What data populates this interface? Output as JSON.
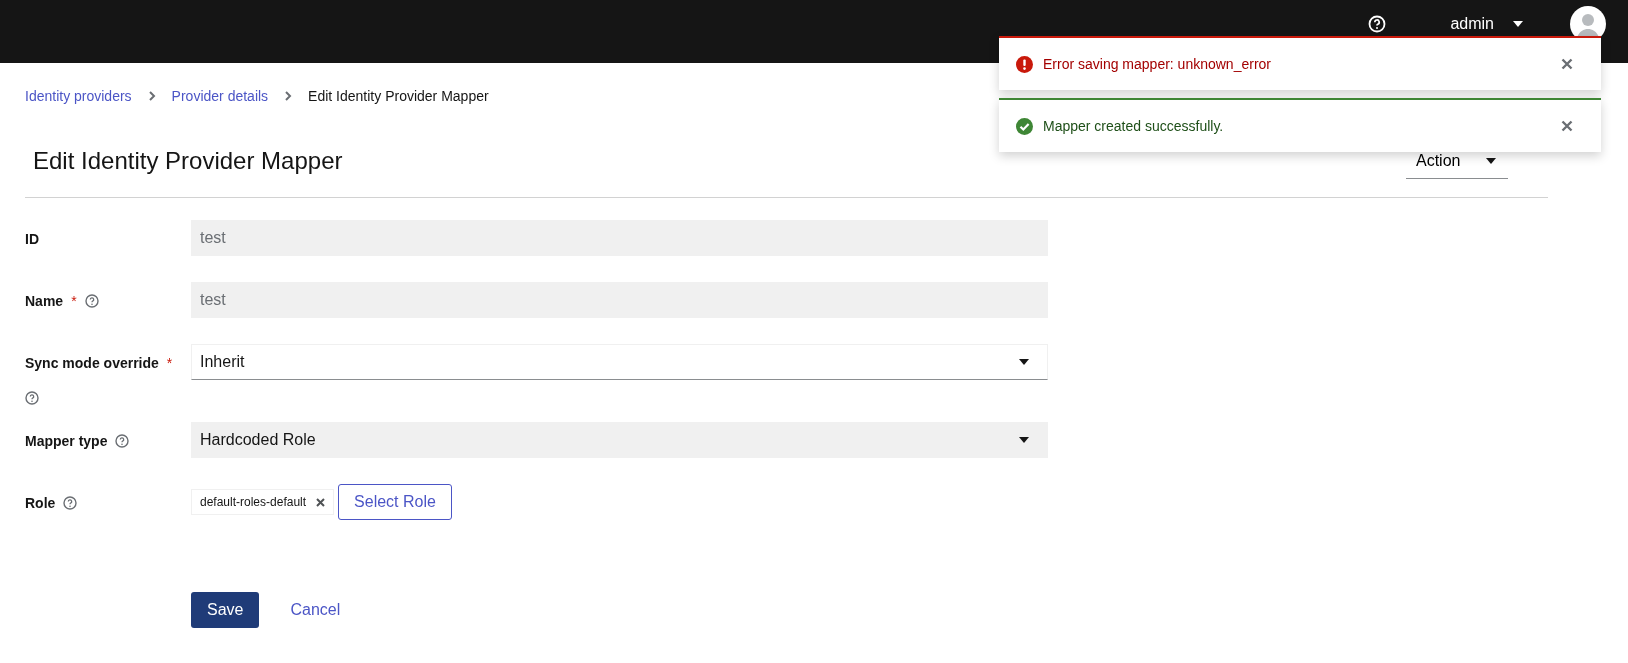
{
  "header": {
    "user": "admin"
  },
  "breadcrumbs": [
    {
      "label": "Identity providers",
      "current": false
    },
    {
      "label": "Provider details",
      "current": false
    },
    {
      "label": "Edit Identity Provider Mapper",
      "current": true
    }
  ],
  "title": "Edit Identity Provider Mapper",
  "action_button": "Action",
  "form": [
    {
      "label": "ID",
      "help": false,
      "kind": "text",
      "value": "test",
      "disabled": true
    },
    {
      "label": "Name",
      "required_mark": "*",
      "help": true,
      "kind": "text",
      "value": "test",
      "disabled": true
    },
    {
      "label": "Sync mode override",
      "required_mark": "*",
      "help": true,
      "kind": "select",
      "value": "Inherit",
      "disabled": false
    },
    {
      "label": "Mapper type",
      "help": true,
      "kind": "select",
      "value": "Hardcoded Role",
      "disabled": true
    },
    {
      "label": "Role",
      "help": true,
      "kind": "chips",
      "chips": [
        "default-roles-default"
      ],
      "button": "Select Role"
    }
  ],
  "buttons": {
    "save": "Save",
    "cancel": "Cancel"
  },
  "alerts": [
    {
      "kind": "danger",
      "message": "Error saving mapper: unknown_error"
    },
    {
      "kind": "success",
      "message": "Mapper created successfully."
    }
  ]
}
